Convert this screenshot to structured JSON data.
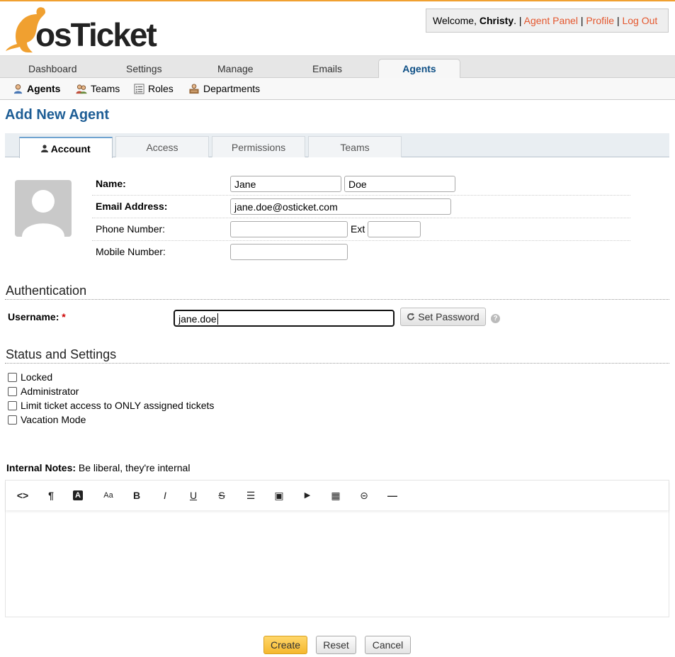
{
  "brand": {
    "logo_text": "osTicket",
    "accent": "#f0a030",
    "link_color": "#e4572e"
  },
  "header": {
    "welcome_prefix": "Welcome,",
    "user_name": "Christy",
    "welcome_suffix": ".",
    "links": [
      "Agent Panel",
      "Profile",
      "Log Out"
    ]
  },
  "main_nav": [
    "Dashboard",
    "Settings",
    "Manage",
    "Emails",
    "Agents"
  ],
  "main_nav_active": "Agents",
  "sub_nav": [
    "Agents",
    "Teams",
    "Roles",
    "Departments"
  ],
  "sub_nav_active": "Agents",
  "page_title": "Add New Agent",
  "form_tabs": [
    "Account",
    "Access",
    "Permissions",
    "Teams"
  ],
  "form_tabs_active": "Account",
  "account": {
    "name_label": "Name:",
    "first_name": "Jane",
    "last_name": "Doe",
    "email_label": "Email Address:",
    "email": "jane.doe@osticket.com",
    "phone_label": "Phone Number:",
    "phone": "",
    "ext_label": "Ext",
    "ext": "",
    "mobile_label": "Mobile Number:",
    "mobile": ""
  },
  "authentication": {
    "title": "Authentication",
    "username_label": "Username:",
    "required_mark": "*",
    "username": "jane.doe",
    "set_password_label": "Set Password",
    "help": "?"
  },
  "status": {
    "title": "Status and Settings",
    "options": [
      {
        "label": "Locked",
        "checked": false
      },
      {
        "label": "Administrator",
        "checked": false
      },
      {
        "label": "Limit ticket access to ONLY assigned tickets",
        "checked": false
      },
      {
        "label": "Vacation Mode",
        "checked": false
      }
    ]
  },
  "notes": {
    "label": "Internal Notes:",
    "hint": "Be liberal, they're internal",
    "toolbar": [
      "html-icon",
      "paragraph-icon",
      "font-color-icon",
      "font-size-icon",
      "bold-icon",
      "italic-icon",
      "underline-icon",
      "strikethrough-icon",
      "list-icon",
      "image-icon",
      "video-icon",
      "table-icon",
      "link-icon",
      "horizontal-rule-icon"
    ],
    "toolbar_glyphs": [
      "<>",
      "¶",
      "A",
      "Aa",
      "B",
      "I",
      "U",
      "S",
      "☰",
      "▣",
      "▶",
      "▦",
      "⊝",
      "—"
    ]
  },
  "actions": {
    "create": "Create",
    "reset": "Reset",
    "cancel": "Cancel"
  }
}
